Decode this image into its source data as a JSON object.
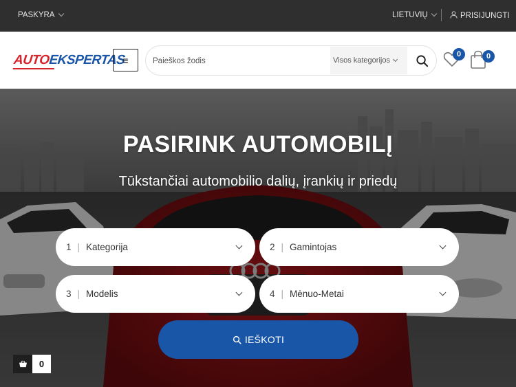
{
  "topbar": {
    "account_label": "PASKYRA",
    "language_label": "LIETUVIŲ",
    "login_label": "PRISIJUNGTI"
  },
  "header": {
    "logo_part1": "AUTO",
    "logo_part2": "EKSPERTAS",
    "menu_icon": "≡",
    "search_placeholder": "Paieškos žodis",
    "category_select": "Visos kategorijos",
    "wishlist_count": "0",
    "cart_count": "0"
  },
  "hero": {
    "title": "PASIRINK AUTOMOBILĮ",
    "subtitle": "Tūkstančiai automobilio dalių, įrankių ir priedų",
    "selects": [
      {
        "num": "1",
        "label": "Kategorija"
      },
      {
        "num": "2",
        "label": "Gamintojas"
      },
      {
        "num": "3",
        "label": "Modelis"
      },
      {
        "num": "4",
        "label": "Mėnuo-Metai"
      }
    ],
    "search_button": "IEŠKOTI"
  },
  "mini_cart": {
    "count": "0"
  },
  "colors": {
    "brand_blue": "#1a56a8",
    "brand_red": "#d7242c",
    "topbar": "#2f2f2f"
  }
}
